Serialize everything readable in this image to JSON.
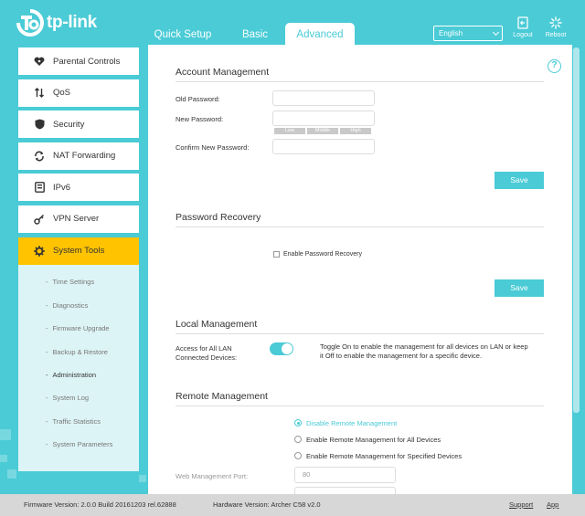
{
  "brand": {
    "name": "tp-link"
  },
  "tabs": [
    {
      "label": "Quick Setup"
    },
    {
      "label": "Basic"
    },
    {
      "label": "Advanced"
    }
  ],
  "language": {
    "selected": "English"
  },
  "header_buttons": {
    "logout": "Logout",
    "reboot": "Reboot"
  },
  "sidebar": {
    "items": [
      {
        "label": "Parental Controls",
        "icon": "heart-icon"
      },
      {
        "label": "QoS",
        "icon": "updown-arrows-icon"
      },
      {
        "label": "Security",
        "icon": "shield-icon"
      },
      {
        "label": "NAT Forwarding",
        "icon": "nat-icon"
      },
      {
        "label": "IPv6",
        "icon": "ipv6-icon"
      },
      {
        "label": "VPN Server",
        "icon": "key-icon"
      },
      {
        "label": "System Tools",
        "icon": "gear-icon"
      }
    ],
    "sub_items": [
      "Time Settings",
      "Diagnostics",
      "Firmware Upgrade",
      "Backup & Restore",
      "Administration",
      "System Log",
      "Traffic Statistics",
      "System Parameters"
    ]
  },
  "account": {
    "title": "Account Management",
    "old_password": "Old Password:",
    "new_password": "New Password:",
    "strength": [
      "Low",
      "Middle",
      "High"
    ],
    "confirm_password": "Confirm New Password:",
    "save": "Save"
  },
  "recovery": {
    "title": "Password Recovery",
    "checkbox_label": "Enable Password Recovery",
    "save": "Save"
  },
  "local": {
    "title": "Local Management",
    "label_line1": "Access for All LAN",
    "label_line2": "Connected Devices:",
    "description": "Toggle On to enable the management for all devices on LAN or keep it Off to enable the management for a specific device."
  },
  "remote": {
    "title": "Remote Management",
    "options": [
      "Disable Remote Management",
      "Enable Remote Management for All Devices",
      "Enable Remote Management for Specified Devices"
    ],
    "port_label": "Web Management Port:",
    "port_value": "80"
  },
  "footer": {
    "firmware": "Firmware Version: 2.0.0 Build 20161203 rel.62888",
    "hardware": "Hardware Version: Archer C58 v2.0",
    "support": "Support",
    "app": "App"
  }
}
